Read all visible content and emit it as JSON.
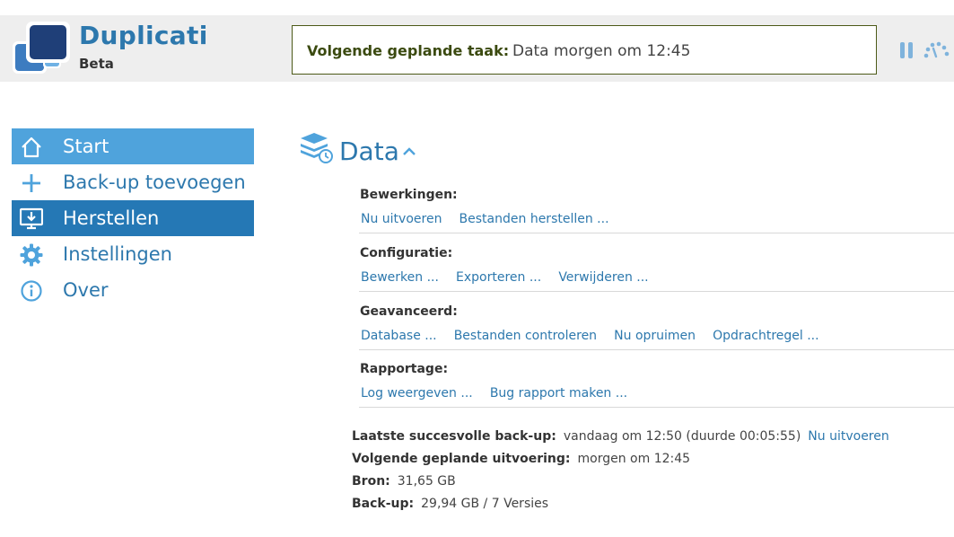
{
  "app": {
    "name": "Duplicati",
    "subtitle": "Beta"
  },
  "status": {
    "label": "Volgende geplande taak:",
    "value": "Data morgen om 12:45"
  },
  "header_icons": [
    "pause-icon",
    "throttle-speed-icon"
  ],
  "nav": {
    "items": [
      {
        "label": "Start",
        "icon": "home-icon"
      },
      {
        "label": "Back-up toevoegen",
        "icon": "plus-icon"
      },
      {
        "label": "Herstellen",
        "icon": "restore-icon"
      },
      {
        "label": "Instellingen",
        "icon": "gear-icon"
      },
      {
        "label": "Over",
        "icon": "info-icon"
      }
    ]
  },
  "backup": {
    "name": "Data",
    "sections": [
      {
        "title": "Bewerkingen:",
        "links": [
          "Nu uitvoeren",
          "Bestanden herstellen ..."
        ]
      },
      {
        "title": "Configuratie:",
        "links": [
          "Bewerken ...",
          "Exporteren ...",
          "Verwijderen ..."
        ]
      },
      {
        "title": "Geavanceerd:",
        "links": [
          "Database ...",
          "Bestanden controleren",
          "Nu opruimen",
          "Opdrachtregel ..."
        ]
      },
      {
        "title": "Rapportage:",
        "links": [
          "Log weergeven ...",
          "Bug rapport maken ..."
        ]
      }
    ],
    "info": {
      "last_label": "Laatste succesvolle back-up:",
      "last_value": "vandaag om 12:50 (duurde 00:05:55)",
      "last_link": "Nu uitvoeren",
      "next_label": "Volgende geplande uitvoering:",
      "next_value": "morgen om 12:45",
      "source_label": "Bron:",
      "source_value": "31,65 GB",
      "backup_label": "Back-up:",
      "backup_value": "29,94 GB / 7 Versies"
    }
  },
  "colors": {
    "accent": "#2d78ad",
    "nav_active_light": "#4fa3dc",
    "nav_active_dark": "#2578b5",
    "status_border": "#4c5a18",
    "header_bg": "#eeeeee"
  }
}
